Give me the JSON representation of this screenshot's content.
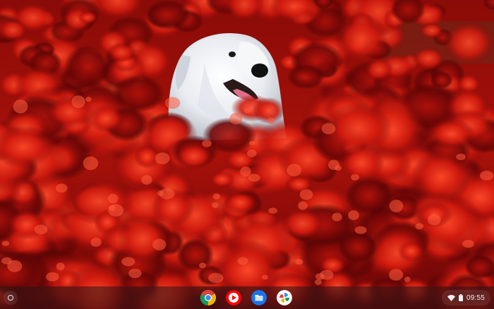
{
  "wallpaper": {
    "subject": "white-dog-in-red-flowers"
  },
  "shelf": {
    "launcher_icon": "launcher-circle-icon",
    "apps": [
      {
        "id": "chrome",
        "icon": "chrome-icon"
      },
      {
        "id": "youtube",
        "icon": "youtube-play-icon"
      },
      {
        "id": "files",
        "icon": "files-folder-icon"
      },
      {
        "id": "settings",
        "icon": "settings-pinwheel-icon"
      }
    ],
    "status": {
      "wifi_icon": "wifi-icon",
      "battery_icon": "battery-icon",
      "time": "09:55"
    }
  },
  "colors": {
    "flower_red": "#c8180f",
    "flower_dark": "#5a0606",
    "dog_white": "#eef0f3",
    "shelf_bg": "#2a1416",
    "chrome_red": "#db4437",
    "chrome_yellow": "#f4b400",
    "chrome_green": "#0f9d58",
    "chrome_blue": "#4285f4",
    "youtube_red": "#ff0000",
    "files_blue": "#1a73e8"
  }
}
